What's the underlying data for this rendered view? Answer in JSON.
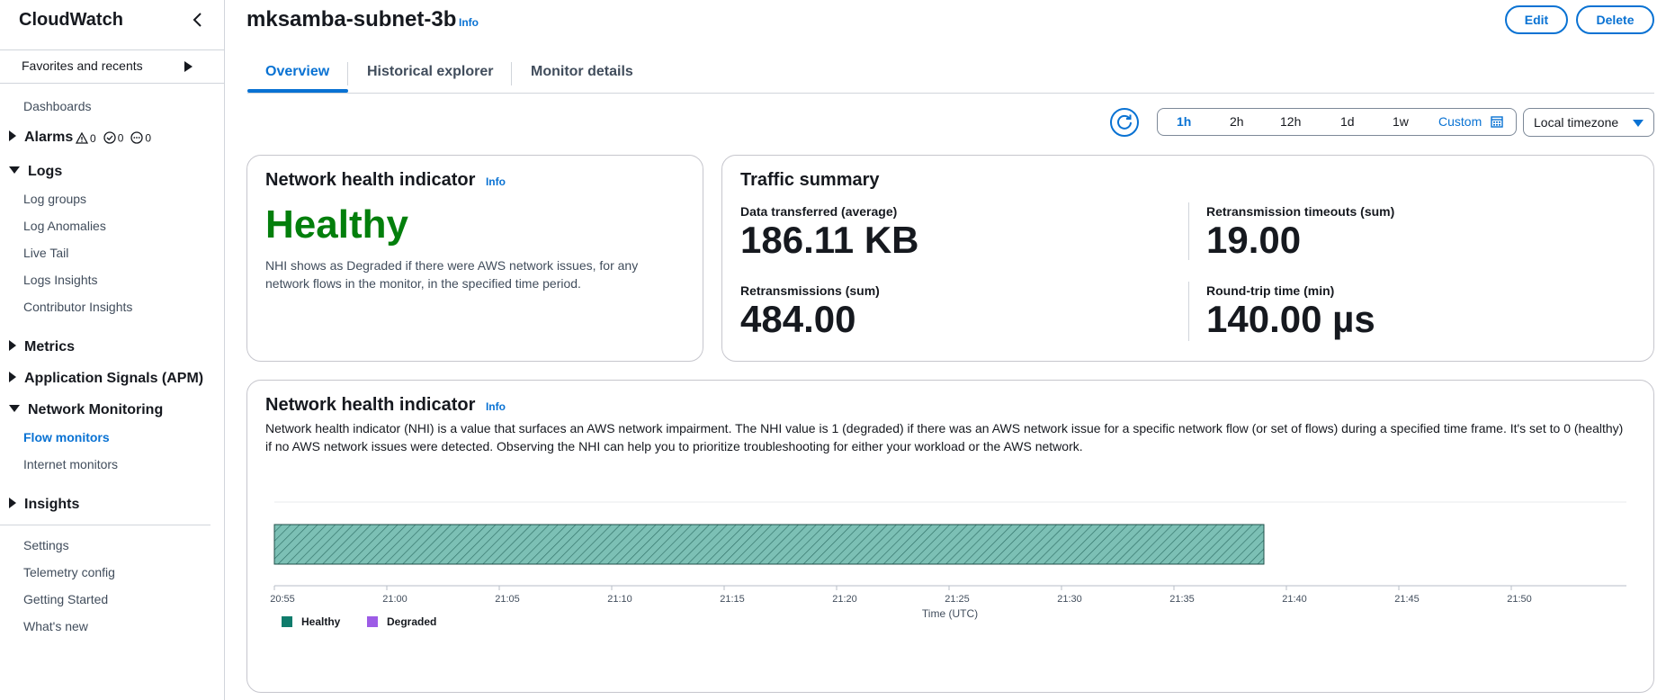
{
  "sidebar": {
    "title": "CloudWatch",
    "favorites_label": "Favorites and recents",
    "dashboards": "Dashboards",
    "alarms": {
      "label": "Alarms",
      "in_alarm": "0",
      "ok": "0",
      "insufficient": "0"
    },
    "logs": {
      "label": "Logs",
      "items": [
        "Log groups",
        "Log Anomalies",
        "Live Tail",
        "Logs Insights",
        "Contributor Insights"
      ]
    },
    "metrics": "Metrics",
    "app_signals": "Application Signals (APM)",
    "network_monitoring": {
      "label": "Network Monitoring",
      "items": [
        "Flow monitors",
        "Internet monitors"
      ]
    },
    "insights": "Insights",
    "footer_items": [
      "Settings",
      "Telemetry config",
      "Getting Started",
      "What's new"
    ]
  },
  "header": {
    "title": "mksamba-subnet-3b",
    "info": "Info",
    "edit_label": "Edit",
    "delete_label": "Delete"
  },
  "tabs": [
    {
      "label": "Overview",
      "active": true
    },
    {
      "label": "Historical explorer",
      "active": false
    },
    {
      "label": "Monitor details",
      "active": false
    }
  ],
  "time_range": {
    "options": [
      "1h",
      "2h",
      "12h",
      "1d",
      "1w",
      "Custom"
    ],
    "selected": "1h",
    "timezone": "Local timezone"
  },
  "nhi_card": {
    "title": "Network health indicator",
    "info": "Info",
    "status": "Healthy",
    "status_color": "#037f0c",
    "description": "NHI shows as Degraded if there were AWS network issues, for any network flows in the monitor, in the specified time period."
  },
  "traffic": {
    "title": "Traffic summary",
    "metrics": [
      {
        "label": "Data transferred (average)",
        "value": "186.11 KB"
      },
      {
        "label": "Retransmission timeouts (sum)",
        "value": "19.00"
      },
      {
        "label": "Retransmissions (sum)",
        "value": "484.00"
      },
      {
        "label": "Round-trip time (min)",
        "value": "140.00 µs"
      }
    ]
  },
  "chart_card": {
    "title": "Network health indicator",
    "info": "Info",
    "description": "Network health indicator (NHI) is a value that surfaces an AWS network impairment. The NHI value is 1 (degraded) if there was an AWS network issue for a specific network flow (or set of flows) during a specified time frame. It's set to 0 (healthy) if no AWS network issues were detected. Observing the NHI can help you to prioritize troubleshooting for either your workload or the AWS network."
  },
  "chart_data": {
    "type": "bar",
    "orientation": "horizontal-timeline",
    "xlabel": "Time (UTC)",
    "x_ticks": [
      "20:55",
      "21:00",
      "21:05",
      "21:10",
      "21:15",
      "21:20",
      "21:25",
      "21:30",
      "21:35",
      "21:40",
      "21:45",
      "21:50"
    ],
    "xlim": [
      "20:55",
      "21:55"
    ],
    "series": [
      {
        "name": "Healthy",
        "color": "#0f7c6c",
        "fill": "#7cc0b5",
        "segments": [
          {
            "start": "20:55",
            "end": "21:39"
          }
        ]
      },
      {
        "name": "Degraded",
        "color": "#9d5ce6",
        "segments": []
      }
    ],
    "legend_position": "bottom-left"
  }
}
